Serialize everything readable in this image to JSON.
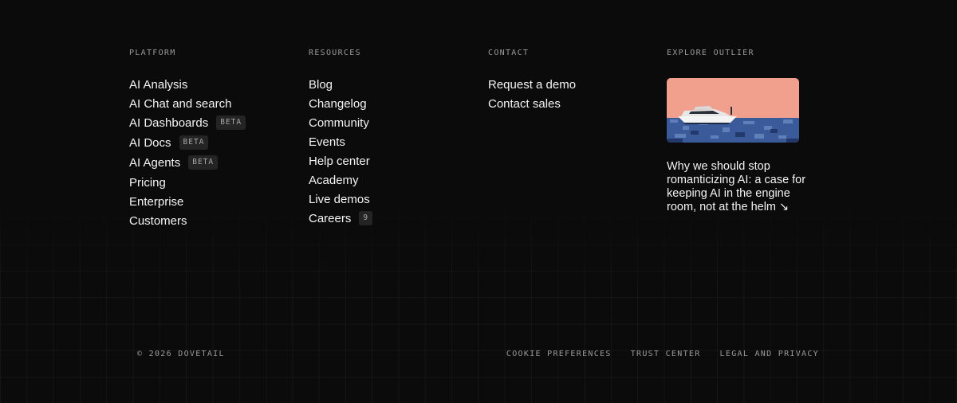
{
  "platform": {
    "heading": "PLATFORM",
    "items": [
      {
        "label": "AI Analysis"
      },
      {
        "label": "AI Chat and search"
      },
      {
        "label": "AI Dashboards",
        "badge": "BETA"
      },
      {
        "label": "AI Docs",
        "badge": "BETA"
      },
      {
        "label": "AI Agents",
        "badge": "BETA"
      },
      {
        "label": "Pricing"
      },
      {
        "label": "Enterprise"
      },
      {
        "label": "Customers"
      }
    ]
  },
  "resources": {
    "heading": "RESOURCES",
    "items": [
      {
        "label": "Blog"
      },
      {
        "label": "Changelog"
      },
      {
        "label": "Community"
      },
      {
        "label": "Events"
      },
      {
        "label": "Help center"
      },
      {
        "label": "Academy"
      },
      {
        "label": "Live demos"
      },
      {
        "label": "Careers",
        "badge": "9"
      }
    ]
  },
  "contact": {
    "heading": "CONTACT",
    "items": [
      {
        "label": "Request a demo"
      },
      {
        "label": "Contact sales"
      }
    ]
  },
  "explore": {
    "heading": "EXPLORE OUTLIER",
    "article_title": "Why we should stop romanticizing AI: a case for keeping AI in the engine room, not at the helm ↘",
    "image_bg": "#f2a08e",
    "water_color": "#3a5a9a"
  },
  "footer": {
    "copyright": "© 2026 DOVETAIL",
    "links": [
      "COOKIE PREFERENCES",
      "TRUST CENTER",
      "LEGAL AND PRIVACY"
    ]
  }
}
